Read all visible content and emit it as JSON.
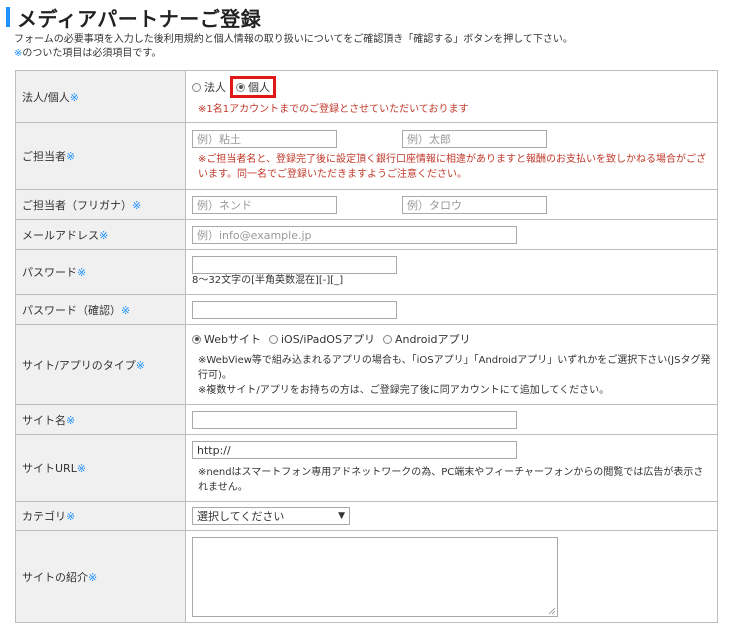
{
  "header": {
    "title": "メディアパートナーご登録",
    "lead_line1": "フォームの必要事項を入力した後利用規約と個人情報の取り扱いについてをご確認頂き「確認する」ボタンを押して下さい。",
    "lead_mark": "※",
    "lead_line2_rest": "のついた項目は必須項目です。"
  },
  "form": {
    "req_mark": "※",
    "entity": {
      "label": "法人/個人",
      "options": [
        "法人",
        "個人"
      ],
      "selected": "個人",
      "notice": "※1名1アカウントまでのご登録とさせていただいております"
    },
    "contact": {
      "label": "ご担当者",
      "last_placeholder": "例）粘土",
      "first_placeholder": "例）太郎",
      "notice": "※ご担当者名と、登録完了後に設定頂く銀行口座情報に相違がありますと報酬のお支払いを致しかねる場合がございます。同一名でご登録いただきますようご注意ください。"
    },
    "contact_kana": {
      "label": "ご担当者（フリガナ）",
      "last_placeholder": "例）ネンド",
      "first_placeholder": "例）タロウ"
    },
    "email": {
      "label": "メールアドレス",
      "placeholder": "例）info@example.jp"
    },
    "password": {
      "label": "パスワード",
      "helper": "8～32文字の[半角英数混在][-][_]"
    },
    "password_confirm": {
      "label": "パスワード（確認）"
    },
    "site_type": {
      "label": "サイト/アプリのタイプ",
      "options": [
        "Webサイト",
        "iOS/iPadOSアプリ",
        "Androidアプリ"
      ],
      "selected": "Webサイト",
      "note1": "※WebView等で組み込まれるアプリの場合も、「iOSアプリ」「Androidアプリ」いずれかをご選択下さい(JSタグ発行可)。",
      "note2": "※複数サイト/アプリをお持ちの方は、ご登録完了後に同アカウントにて追加してください。"
    },
    "site_name": {
      "label": "サイト名"
    },
    "site_url": {
      "label": "サイトURL",
      "value": "http://",
      "note": "※nendはスマートフォン専用アドネットワークの為、PC端末やフィーチャーフォンからの閲覧では広告が表示されません。"
    },
    "category": {
      "label": "カテゴリ",
      "selected": "選択してください"
    },
    "site_intro": {
      "label": "サイトの紹介"
    }
  },
  "colors": {
    "accent": "#1e90ff",
    "notice_red": "#c0392b",
    "highlight_red": "#e01818",
    "label_bg": "#f0f0f0"
  }
}
